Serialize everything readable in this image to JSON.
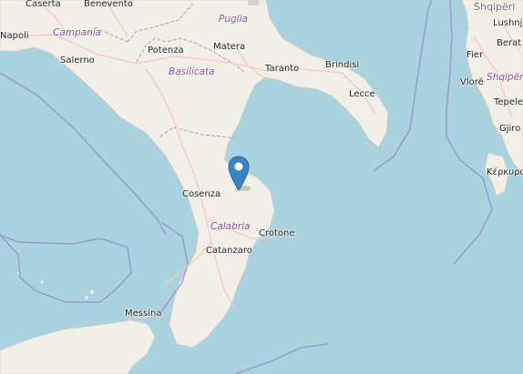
{
  "map": {
    "cities": {
      "caserta": "Caserta",
      "benevento": "Benevento",
      "napoli": "Napoli",
      "salerno": "Salerno",
      "potenza": "Potenza",
      "matera": "Matera",
      "taranto": "Taranto",
      "brindisi": "Brindisi",
      "lecce": "Lecce",
      "cosenza": "Cosenza",
      "crotone": "Crotone",
      "catanzaro": "Catanzaro",
      "messina": "Messina",
      "lushnje": "Lushnjë",
      "fier": "Fier",
      "berat": "Berat",
      "vlore": "Vlorë",
      "tepelene": "Tepelen",
      "gjirokaster": "Gjiro",
      "kerkyra": "Κέρκυρα"
    },
    "regions": {
      "campania": "Campania",
      "puglia": "Puglia",
      "basilicata": "Basilicata",
      "calabria": "Calabria",
      "shqiperi_region": "Shqipëri"
    },
    "country": {
      "albania": "Shqipëri"
    },
    "colors": {
      "sea": "#aad3df",
      "land": "#f2efe9",
      "border": "#9b8fb8",
      "road": "#f6c7bd",
      "pin": "#3a83c4"
    },
    "marker": {
      "icon": "map-pin-icon"
    }
  }
}
